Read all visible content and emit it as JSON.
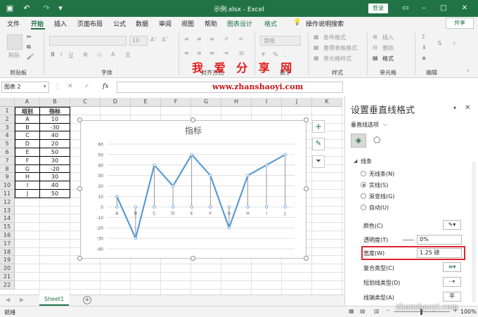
{
  "titlebar": {
    "title": "示例.xlsx  -  Excel",
    "login": "登录",
    "autosave_icon": "save-icon",
    "undo_icon": "undo-icon",
    "redo_icon": "redo-icon"
  },
  "menu": {
    "tabs": [
      "文件",
      "开始",
      "插入",
      "页面布局",
      "公式",
      "数据",
      "审阅",
      "视图",
      "帮助",
      "图表设计",
      "格式",
      "操作说明搜索"
    ],
    "active": "开始",
    "share": "共享"
  },
  "ribbon": {
    "groups": [
      "剪贴板",
      "字体",
      "对齐方式",
      "数字",
      "样式",
      "单元格",
      "编辑"
    ],
    "paste": "粘贴",
    "percent": "%",
    "font_size": "10",
    "style_items": [
      "条件格式",
      "套用表格格式",
      "单元格样式"
    ],
    "cell_items": [
      "插入",
      "删除",
      "格式"
    ],
    "number_format_placeholder": "常规"
  },
  "watermark": {
    "line1": "我 爱 分 享 网",
    "line2": "www.zhanshaoyi.com",
    "line3": "zhanshaoyi.com"
  },
  "formula_bar": {
    "name_box": "图表 2",
    "fx": "fx",
    "cancel": "✕",
    "confirm": "✓",
    "value": ""
  },
  "grid": {
    "columns": [
      "A",
      "B",
      "C",
      "D",
      "E",
      "F",
      "G",
      "H",
      "I",
      "J",
      "K"
    ],
    "rows": [
      "1",
      "2",
      "3",
      "4",
      "5",
      "6",
      "7",
      "8",
      "9",
      "10",
      "11",
      "12",
      "13",
      "14",
      "15",
      "16",
      "17",
      "18",
      "19",
      "20",
      "21",
      "22"
    ],
    "table_header": [
      "组别",
      "指标"
    ],
    "table_rows": [
      [
        "A",
        "10"
      ],
      [
        "B",
        "-30"
      ],
      [
        "C",
        "40"
      ],
      [
        "D",
        "20"
      ],
      [
        "E",
        "50"
      ],
      [
        "F",
        "30"
      ],
      [
        "G",
        "-20"
      ],
      [
        "H",
        "30"
      ],
      [
        "I",
        "40"
      ],
      [
        "J",
        "50"
      ]
    ]
  },
  "chart_data": {
    "type": "line",
    "title": "指标",
    "categories": [
      "A",
      "B",
      "C",
      "D",
      "E",
      "F",
      "G",
      "H",
      "I",
      "J"
    ],
    "series": [
      {
        "values": [
          10,
          -30,
          40,
          20,
          50,
          30,
          -20,
          30,
          40,
          50
        ]
      }
    ],
    "xlabel": "",
    "ylabel": "",
    "ylim": [
      -40,
      60
    ],
    "yticks": [
      "60",
      "50",
      "40",
      "30",
      "20",
      "10",
      "0",
      "-10",
      "-20",
      "-30",
      "-40"
    ],
    "drop_lines": true,
    "grid": true,
    "line_color": "#5B9BD5"
  },
  "sheet": {
    "tab": "Sheet1",
    "add": "+"
  },
  "status": {
    "ready": "就绪",
    "zoom": "100%"
  },
  "pane": {
    "title": "设置垂直线格式",
    "subtitle": "垂直线选项",
    "section": "线条",
    "line_options": [
      "无线条(N)",
      "实线(S)",
      "渐变线(G)",
      "自动(U)"
    ],
    "selected_option": "实线(S)",
    "labels": {
      "color": "颜色(C)",
      "transparency": "透明度(T)",
      "width": "宽度(W)",
      "compound": "复合类型(C)",
      "dash": "短划线类型(D)",
      "cap": "线端类型(A)"
    },
    "values": {
      "transparency": "0%",
      "width": "1.25 磅",
      "cap": "平"
    }
  }
}
